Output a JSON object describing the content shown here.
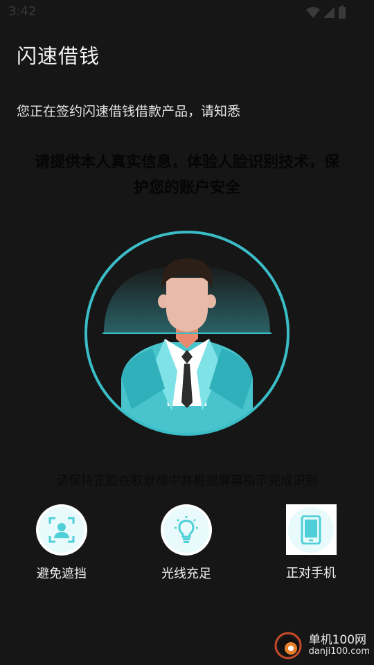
{
  "status_bar": {
    "time": "3:42",
    "icons": [
      "wifi-icon",
      "cell-signal-icon",
      "battery-icon"
    ]
  },
  "app": {
    "title": "闪速借钱"
  },
  "notice": "您正在签约闪速借钱借款产品，请知悉",
  "headline": "请提供本人真实信息，体验人脸识别技术，保护您的账户安全",
  "face_frame": {
    "ring_color": "#3bbdc7",
    "icon": "face-portrait-illustration"
  },
  "instruction": "请保持正脸在取景框中并根据屏幕指示完成识别",
  "tips": [
    {
      "label": "避免遮挡",
      "icon": "face-scan-icon"
    },
    {
      "label": "光线充足",
      "icon": "lightbulb-icon"
    },
    {
      "label": "正对手机",
      "icon": "phone-icon"
    }
  ],
  "watermark": {
    "brand": "单机100网",
    "url": "danji100.com"
  },
  "colors": {
    "background": "#161616",
    "accent": "#3bbdc7",
    "tip_icon": "#4fd0d8"
  }
}
